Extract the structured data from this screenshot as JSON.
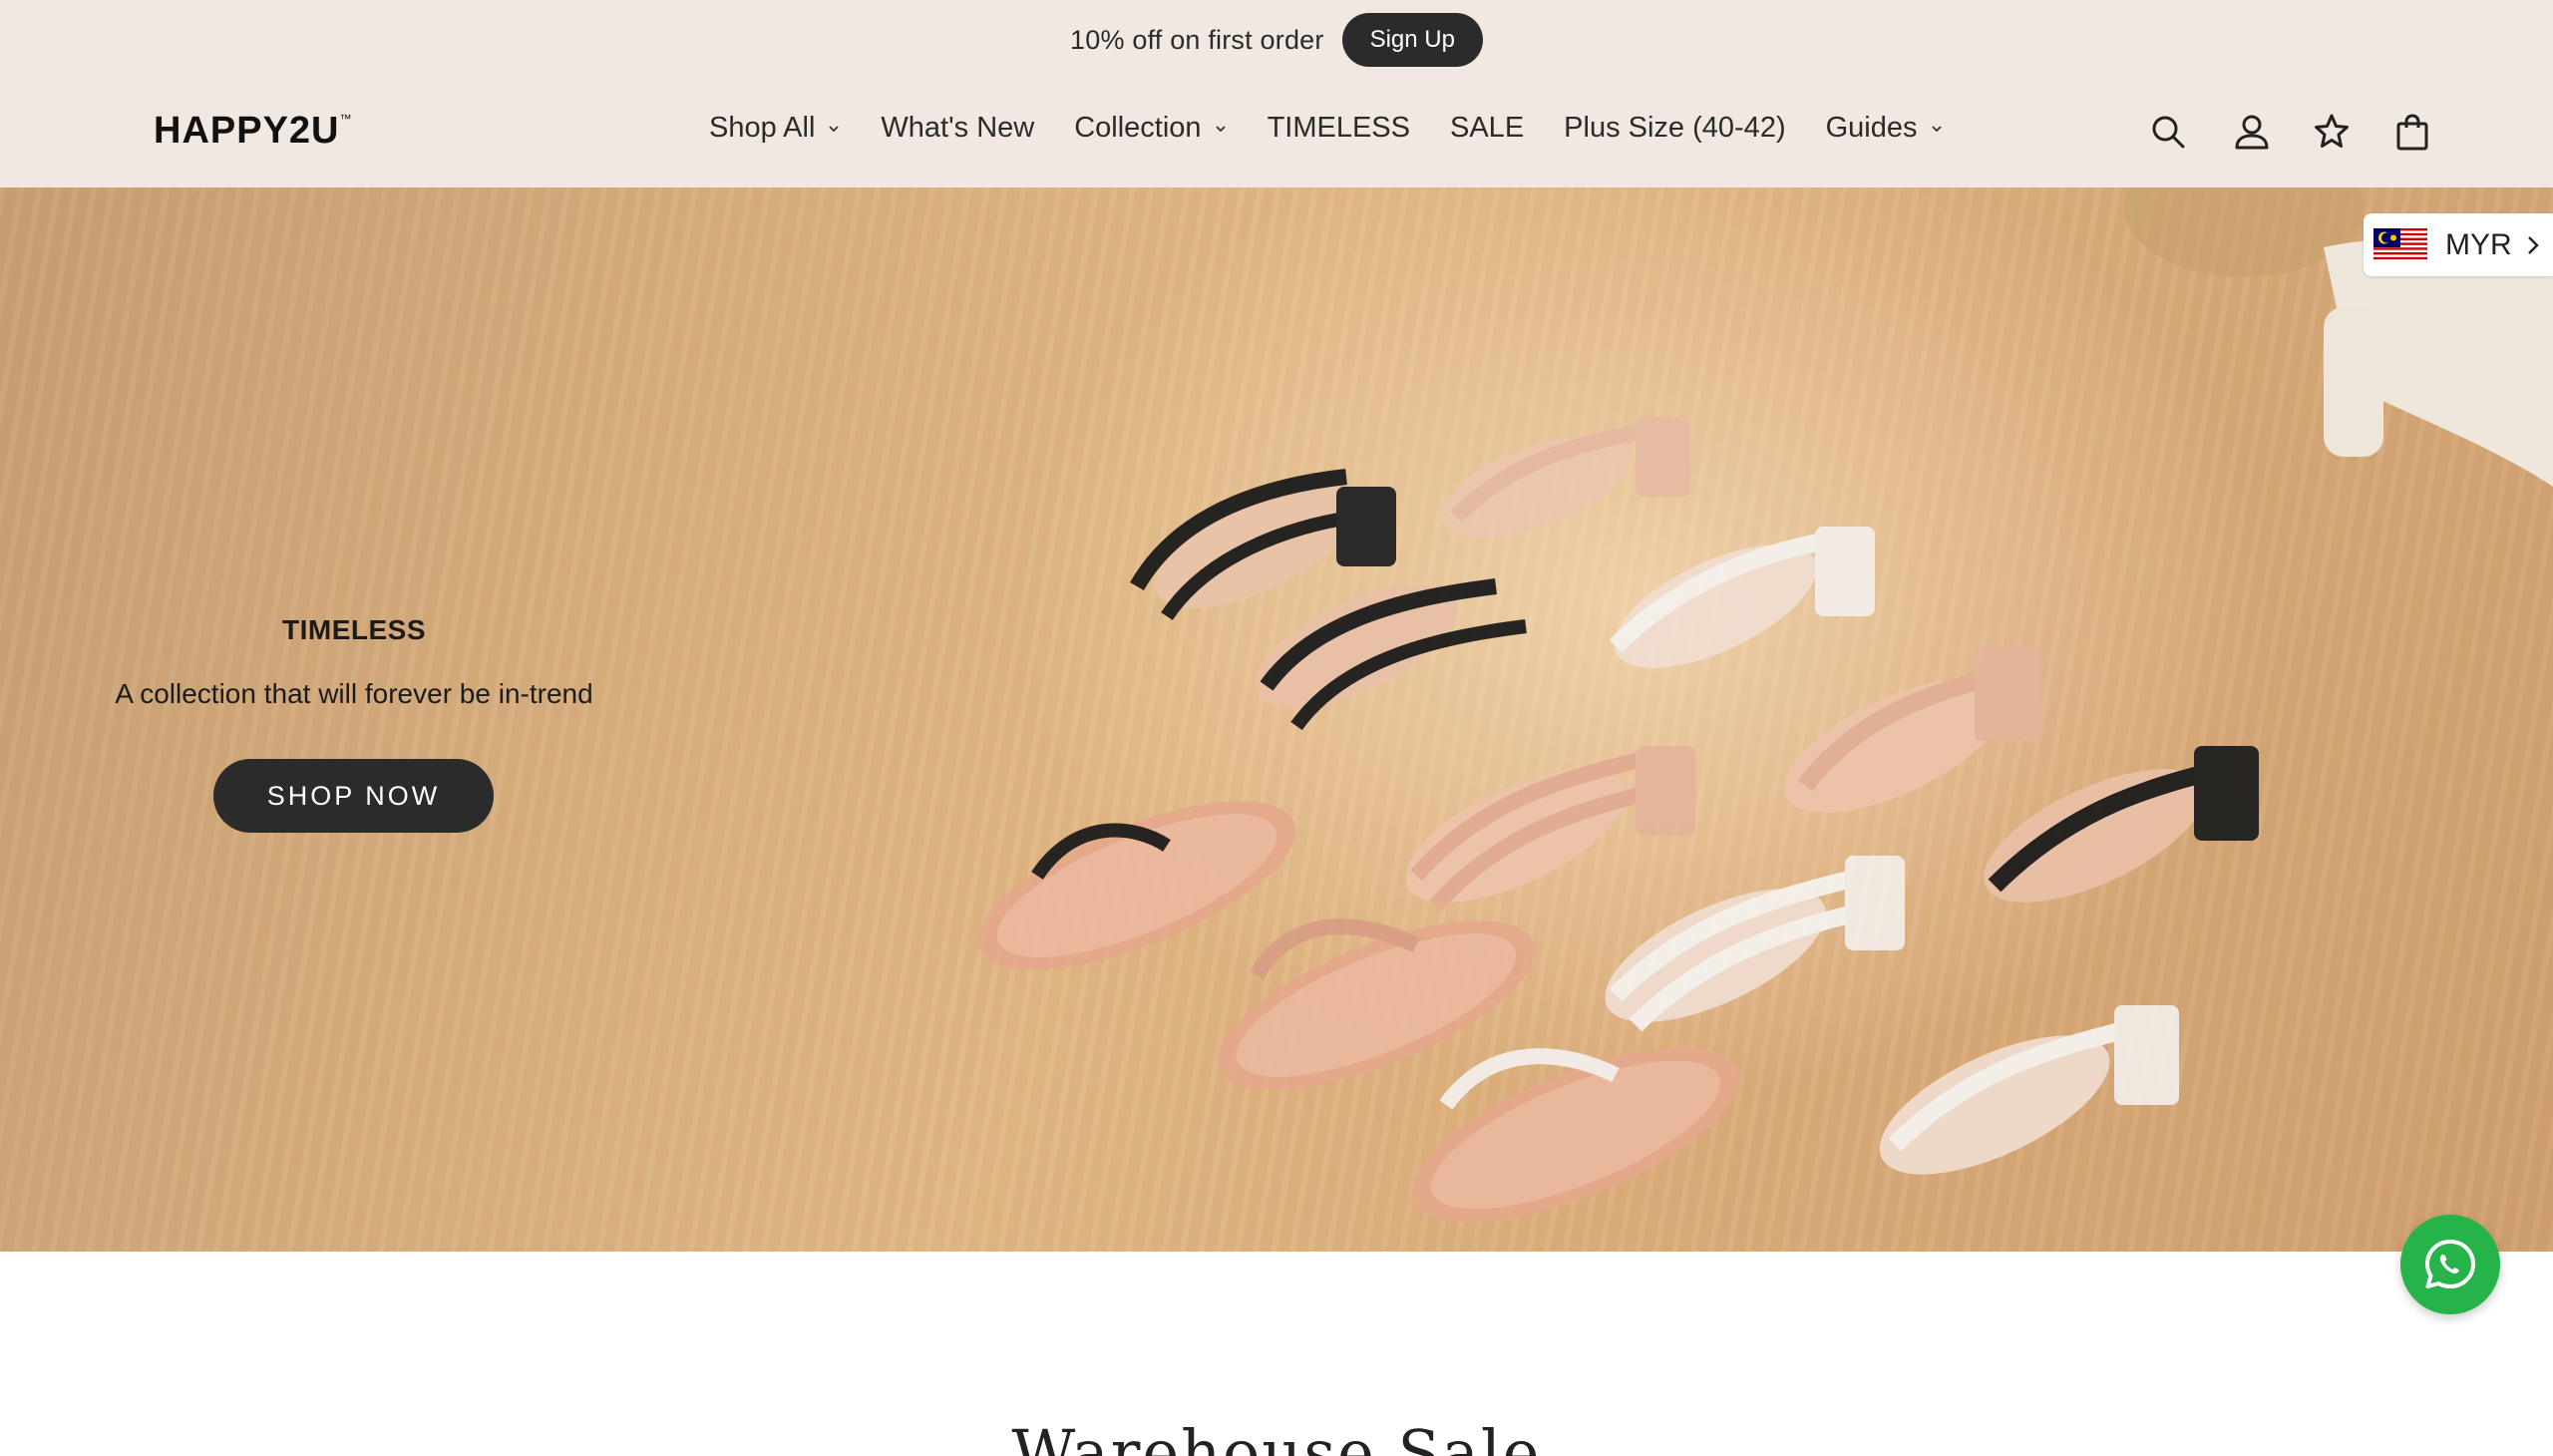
{
  "announcement": {
    "text": "10% off on first order",
    "signup_label": "Sign Up"
  },
  "header": {
    "logo": "HAPPY2U",
    "nav": [
      {
        "label": "Shop All",
        "dropdown": true
      },
      {
        "label": "What's New",
        "dropdown": false
      },
      {
        "label": "Collection",
        "dropdown": true
      },
      {
        "label": "TIMELESS",
        "dropdown": false
      },
      {
        "label": "SALE",
        "dropdown": false
      },
      {
        "label": "Plus Size (40-42)",
        "dropdown": false
      },
      {
        "label": "Guides",
        "dropdown": true
      }
    ],
    "icons": [
      "search-icon",
      "account-icon",
      "wishlist-star-icon",
      "cart-bag-icon"
    ]
  },
  "hero": {
    "title": "TIMELESS",
    "subtitle": "A collection that will forever be in-trend",
    "cta_label": "SHOP NOW"
  },
  "currency": {
    "code": "MYR",
    "flag": "malaysia-flag"
  },
  "section": {
    "title": "Warehouse Sale"
  },
  "colors": {
    "topbar_bg": "#f1e9e1",
    "button_dark": "#2b2b2b",
    "whatsapp_green": "#26b34a"
  }
}
